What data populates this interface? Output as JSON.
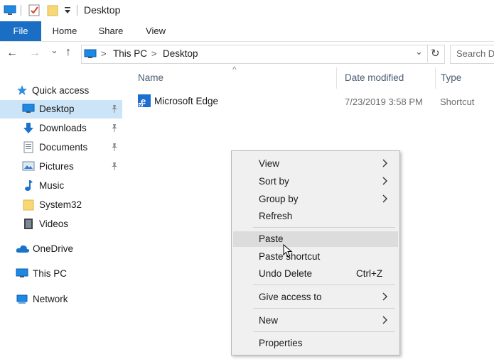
{
  "window": {
    "title": "Desktop"
  },
  "ribbon": {
    "tabs": [
      "File",
      "Home",
      "Share",
      "View"
    ]
  },
  "address": {
    "path": [
      "This PC",
      "Desktop"
    ],
    "separator": ">",
    "search_placeholder": "Search D"
  },
  "icons": {
    "back": "←",
    "forward": "→",
    "history": "⌄",
    "up": "↑",
    "refresh": "↻",
    "dropdown": "⌄",
    "pin": "📌",
    "submenu": "❯",
    "sort": "^"
  },
  "nav": {
    "quick_access": "Quick access",
    "quick_items": [
      {
        "label": "Desktop",
        "icon": "desktop-icon",
        "pinned": true,
        "selected": true
      },
      {
        "label": "Downloads",
        "icon": "download-icon",
        "pinned": true
      },
      {
        "label": "Documents",
        "icon": "document-icon",
        "pinned": true
      },
      {
        "label": "Pictures",
        "icon": "pictures-icon",
        "pinned": true
      },
      {
        "label": "Music",
        "icon": "music-icon",
        "pinned": false
      },
      {
        "label": "System32",
        "icon": "folder-icon",
        "pinned": false
      },
      {
        "label": "Videos",
        "icon": "videos-icon",
        "pinned": false
      }
    ],
    "onedrive": "OneDrive",
    "thispc": "This PC",
    "network": "Network"
  },
  "columns": {
    "name": "Name",
    "date": "Date modified",
    "type": "Type"
  },
  "files": [
    {
      "name": "Microsoft Edge",
      "date": "7/23/2019 3:58 PM",
      "type": "Shortcut",
      "icon": "edge-icon"
    }
  ],
  "context_menu": {
    "view": "View",
    "sort_by": "Sort by",
    "group_by": "Group by",
    "refresh": "Refresh",
    "paste": "Paste",
    "paste_shortcut": "Paste shortcut",
    "undo_delete": "Undo Delete",
    "undo_shortcut": "Ctrl+Z",
    "give_access": "Give access to",
    "new": "New",
    "properties": "Properties"
  },
  "colors": {
    "accent": "#1a6fc4",
    "selection": "#cce4f7",
    "menu_bg": "#f0f0f0"
  }
}
